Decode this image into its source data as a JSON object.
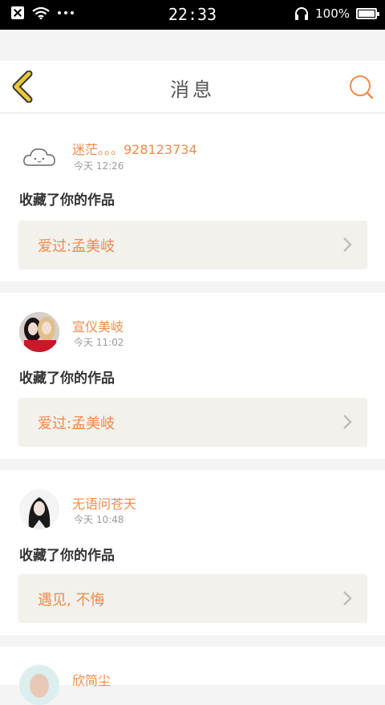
{
  "status_bar": {
    "time": "22:33",
    "battery": "100%",
    "battery_level": 1.0
  },
  "header": {
    "title": "消息"
  },
  "messages": [
    {
      "username": "迷茫。。。928123734",
      "time": "今天 12:26",
      "action": "收藏了你的作品",
      "work_title": "爱过:孟美岐",
      "avatar_icon": "cloud-avatar"
    },
    {
      "username": "宣仪美岐",
      "time": "今天 11:02",
      "action": "收藏了你的作品",
      "work_title": "爱过:孟美岐",
      "avatar_icon": "two-girls-photo"
    },
    {
      "username": "无语问苍天",
      "time": "今天 10:48",
      "action": "收藏了你的作品",
      "work_title": "遇见, 不悔",
      "avatar_icon": "girl-photo"
    },
    {
      "username": "欣简尘",
      "avatar_icon": "girl-photo"
    }
  ],
  "colors": {
    "accent": "#f08a4b",
    "back": "#e6c93a",
    "work_bg": "#f2f1ec"
  }
}
